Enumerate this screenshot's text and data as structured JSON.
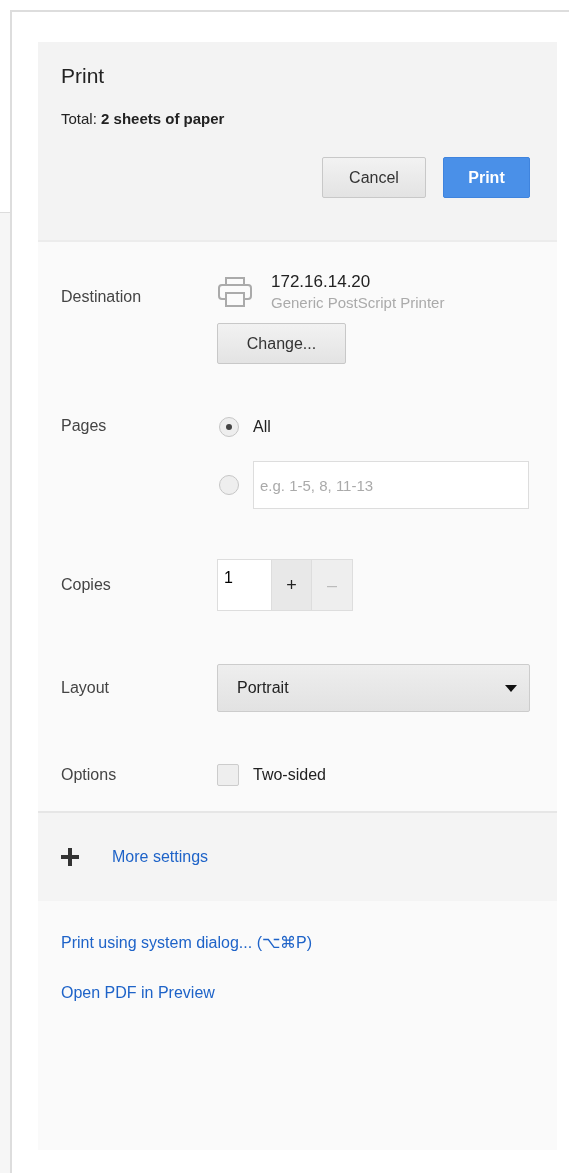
{
  "dialog": {
    "title": "Print",
    "summary": "Total: **2 sheets of paper**",
    "buttons": [
      {
        "label": "Cancel",
        "kind": "secondary"
      },
      {
        "label": "Print",
        "kind": "primary"
      }
    ]
  },
  "destination": {
    "label": "Destination",
    "name": "172.16.14.20",
    "description": "Generic PostScript Printer",
    "change_button": "Change..."
  },
  "pages": {
    "label": "Pages",
    "options": [
      {
        "kind": "all",
        "label": "All",
        "selected": true
      },
      {
        "kind": "range",
        "placeholder": "e.g. 1-5, 8, 11-13",
        "selected": false
      }
    ]
  },
  "copies": {
    "label": "Copies",
    "value": "1",
    "buttons": [
      {
        "label": "+",
        "disabled": false
      },
      {
        "label": "–",
        "disabled": true
      }
    ]
  },
  "layout": {
    "label": "Layout",
    "value": "Portrait"
  },
  "options": {
    "label": "Options",
    "items": [
      {
        "label": "Two-sided",
        "checked": false
      }
    ]
  },
  "more_settings": {
    "label": "More settings"
  },
  "links": [
    "Print using system dialog... (⌥⌘P)",
    "Open PDF in Preview"
  ]
}
